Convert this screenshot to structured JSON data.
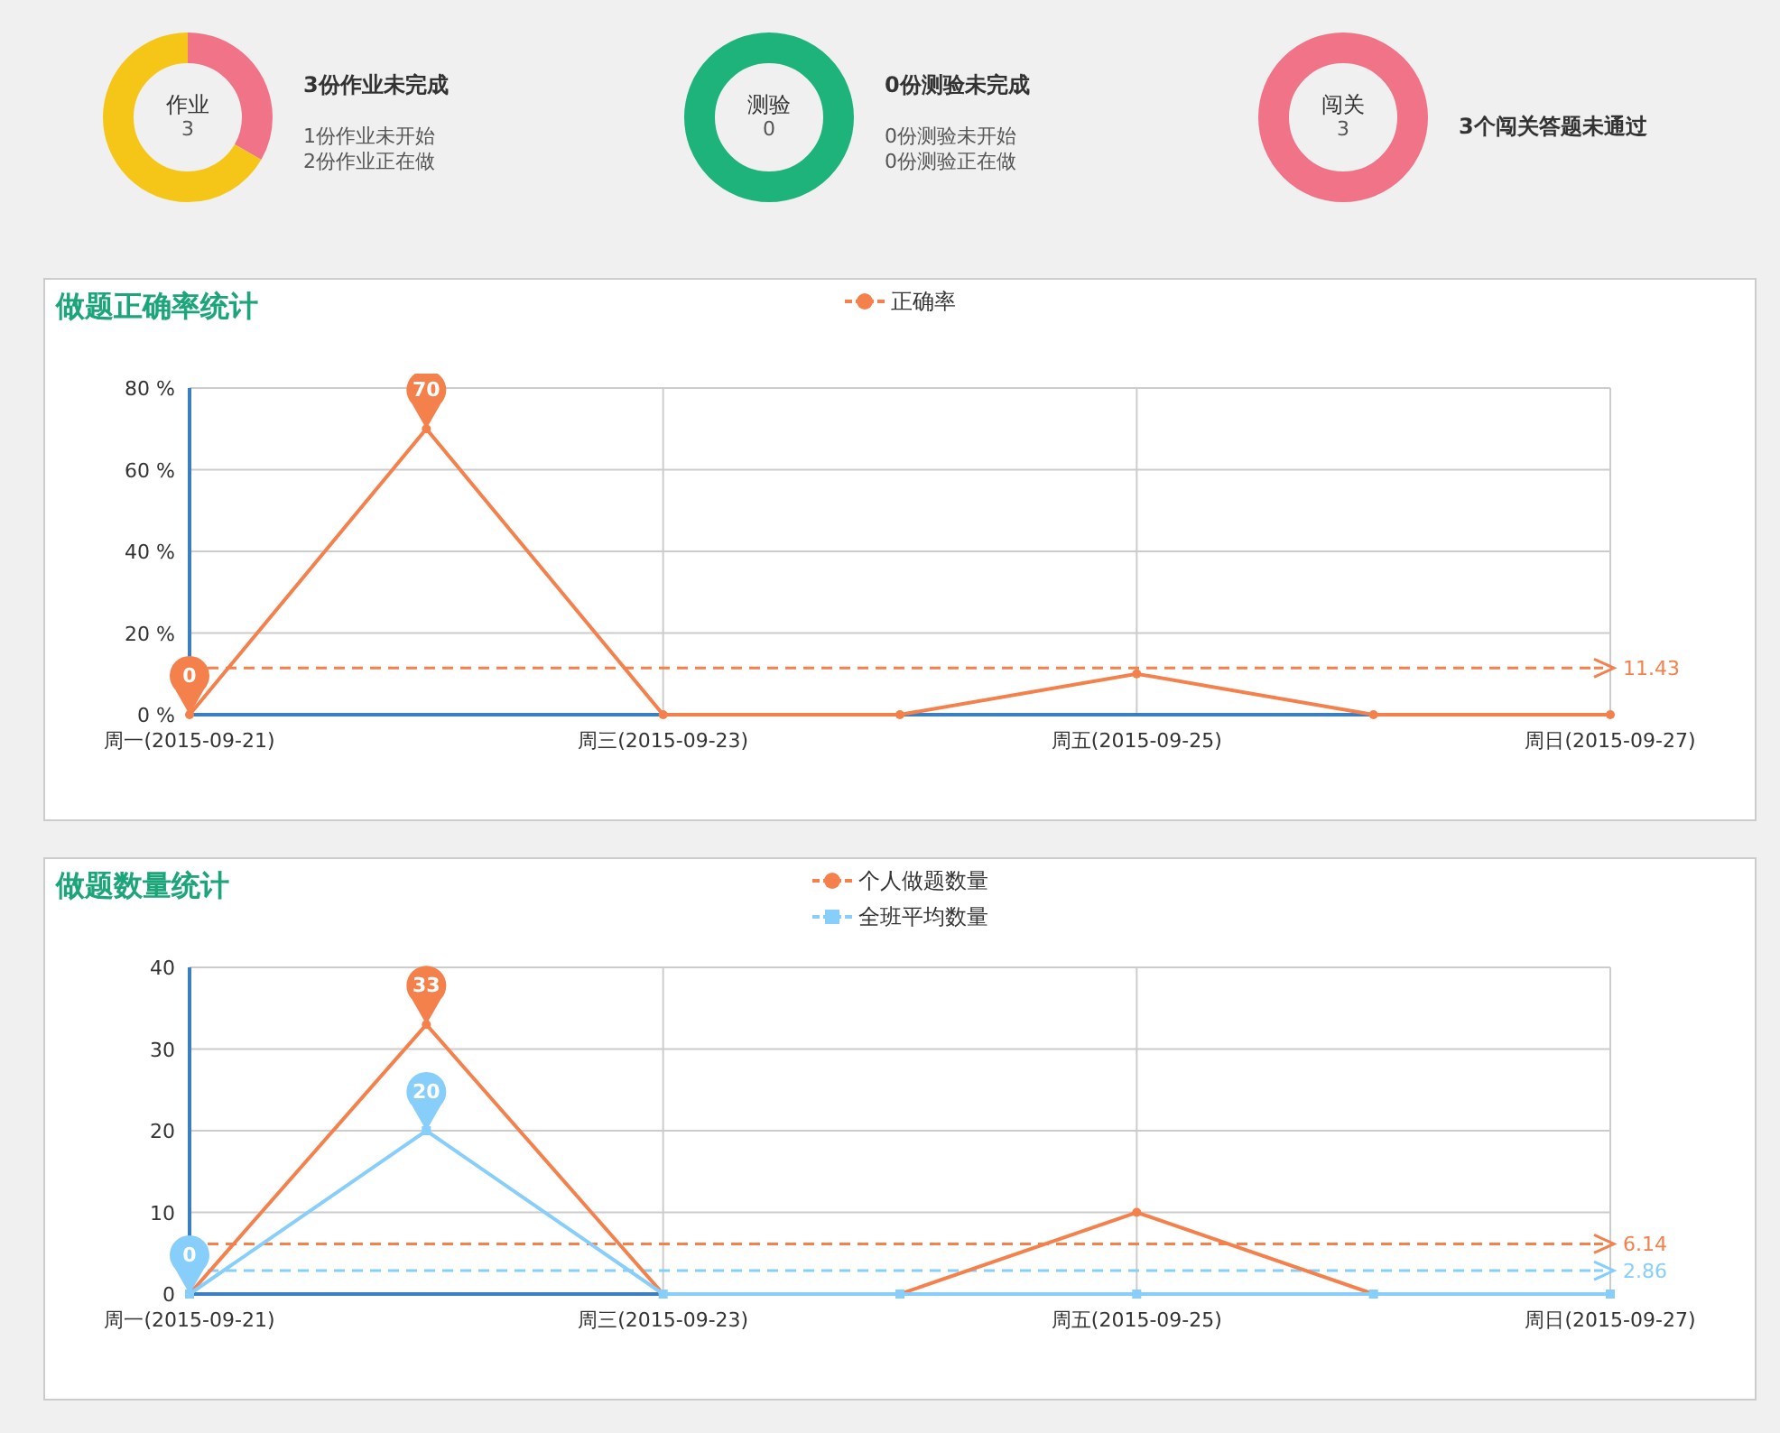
{
  "summary": [
    {
      "name": "作业",
      "count": "3",
      "headline": "3份作业未完成",
      "details": [
        "1份作业未开始",
        "2份作业正在做"
      ],
      "ring": [
        {
          "color": "#f07388",
          "level": 0.333
        },
        {
          "color": "#f5c518",
          "level": 0.667
        }
      ]
    },
    {
      "name": "测验",
      "count": "0",
      "headline": "0份测验未完成",
      "details": [
        "0份测验未开始",
        "0份测验正在做"
      ],
      "ring": [
        {
          "color": "#1db37a",
          "level": 1
        }
      ]
    },
    {
      "name": "闯关",
      "count": "3",
      "headline": "3个闯关答题未通过",
      "ring": [
        {
          "color": "#f07388",
          "level": 1
        }
      ]
    }
  ],
  "charts": [
    {
      "title": "做题正确率统计",
      "chart_data": {
        "type": "line",
        "grid": true,
        "categories": [
          "周一(2015-09-21)",
          null,
          "周三(2015-09-23)",
          null,
          "周五(2015-09-25)",
          null,
          "周日(2015-09-27)"
        ],
        "ylim": [
          0,
          80
        ],
        "yticks": [
          {
            "value": 0,
            "label": "0 %"
          },
          {
            "value": 20,
            "label": "20 %"
          },
          {
            "value": 40,
            "label": "40 %"
          },
          {
            "value": 60,
            "label": "60 %"
          },
          {
            "value": 80,
            "label": "80 %"
          }
        ],
        "series": [
          {
            "name": "正确率",
            "color": "#f4804c",
            "marker": "circle",
            "values": [
              0,
              70,
              0,
              0,
              10,
              0,
              0
            ]
          }
        ],
        "ref_lines": [
          {
            "axis": "y",
            "value": 11.43,
            "label": "11.43",
            "color": "#f4804c"
          }
        ],
        "annotations": [
          {
            "text": "70",
            "y": 70
          },
          {
            "text": "0",
            "y": 0
          }
        ]
      }
    },
    {
      "title": "做题数量统计",
      "chart_data": {
        "type": "line",
        "grid": true,
        "categories": [
          "周一(2015-09-21)",
          null,
          "周三(2015-09-23)",
          null,
          "周五(2015-09-25)",
          null,
          "周日(2015-09-27)"
        ],
        "ylim": [
          0,
          40
        ],
        "yticks": [
          {
            "value": 0,
            "label": "0"
          },
          {
            "value": 10,
            "label": "10"
          },
          {
            "value": 20,
            "label": "20"
          },
          {
            "value": 30,
            "label": "30"
          },
          {
            "value": 40,
            "label": "40"
          }
        ],
        "series": [
          {
            "name": "个人做题数量",
            "color": "#f4804c",
            "marker": "circle",
            "values": [
              0,
              33,
              0,
              0,
              10,
              0,
              0
            ]
          },
          {
            "name": "全班平均数量",
            "color": "#87cefa",
            "marker": "square",
            "values": [
              0,
              20,
              0,
              0,
              0,
              0,
              0
            ]
          }
        ],
        "ref_lines": [
          {
            "axis": "y",
            "value": 6.14,
            "label": "6.14",
            "color": "#f4804c"
          },
          {
            "axis": "y",
            "value": 2.86,
            "label": "2.86",
            "color": "#87cefa"
          }
        ],
        "annotations": [
          {
            "text": "33",
            "y": 33
          },
          {
            "text": "20",
            "y": 20
          },
          {
            "text": "0",
            "y": 0
          }
        ]
      }
    }
  ]
}
